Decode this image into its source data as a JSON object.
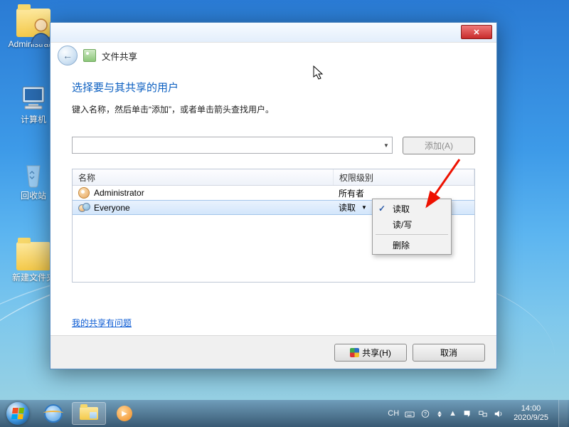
{
  "desktop": {
    "icons": [
      {
        "label": "Administrator",
        "kind": "folder-user"
      },
      {
        "label": "计算机",
        "kind": "computer"
      },
      {
        "label": "回收站",
        "kind": "recycle"
      },
      {
        "label": "新建文件夹",
        "kind": "folder"
      }
    ]
  },
  "dialog": {
    "window_title": "文件共享",
    "heading": "选择要与其共享的用户",
    "subtext": "键入名称，然后单击“添加”，或者单击箭头查找用户。",
    "add_btn": "添加(A)",
    "columns": {
      "name": "名称",
      "perm": "权限级别"
    },
    "rows": [
      {
        "name": "Administrator",
        "perm": "所有者",
        "icon": "user"
      },
      {
        "name": "Everyone",
        "perm": "读取",
        "icon": "group",
        "selected": true,
        "dropdown": true
      }
    ],
    "help_link": "我的共享有问题",
    "share_btn": "共享(H)",
    "cancel_btn": "取消"
  },
  "context_menu": {
    "items": [
      {
        "label": "读取",
        "checked": true
      },
      {
        "label": "读/写"
      },
      {
        "sep": true
      },
      {
        "label": "删除"
      }
    ]
  },
  "taskbar": {
    "lang": "CH",
    "time": "14:00",
    "date": "2020/9/25"
  }
}
